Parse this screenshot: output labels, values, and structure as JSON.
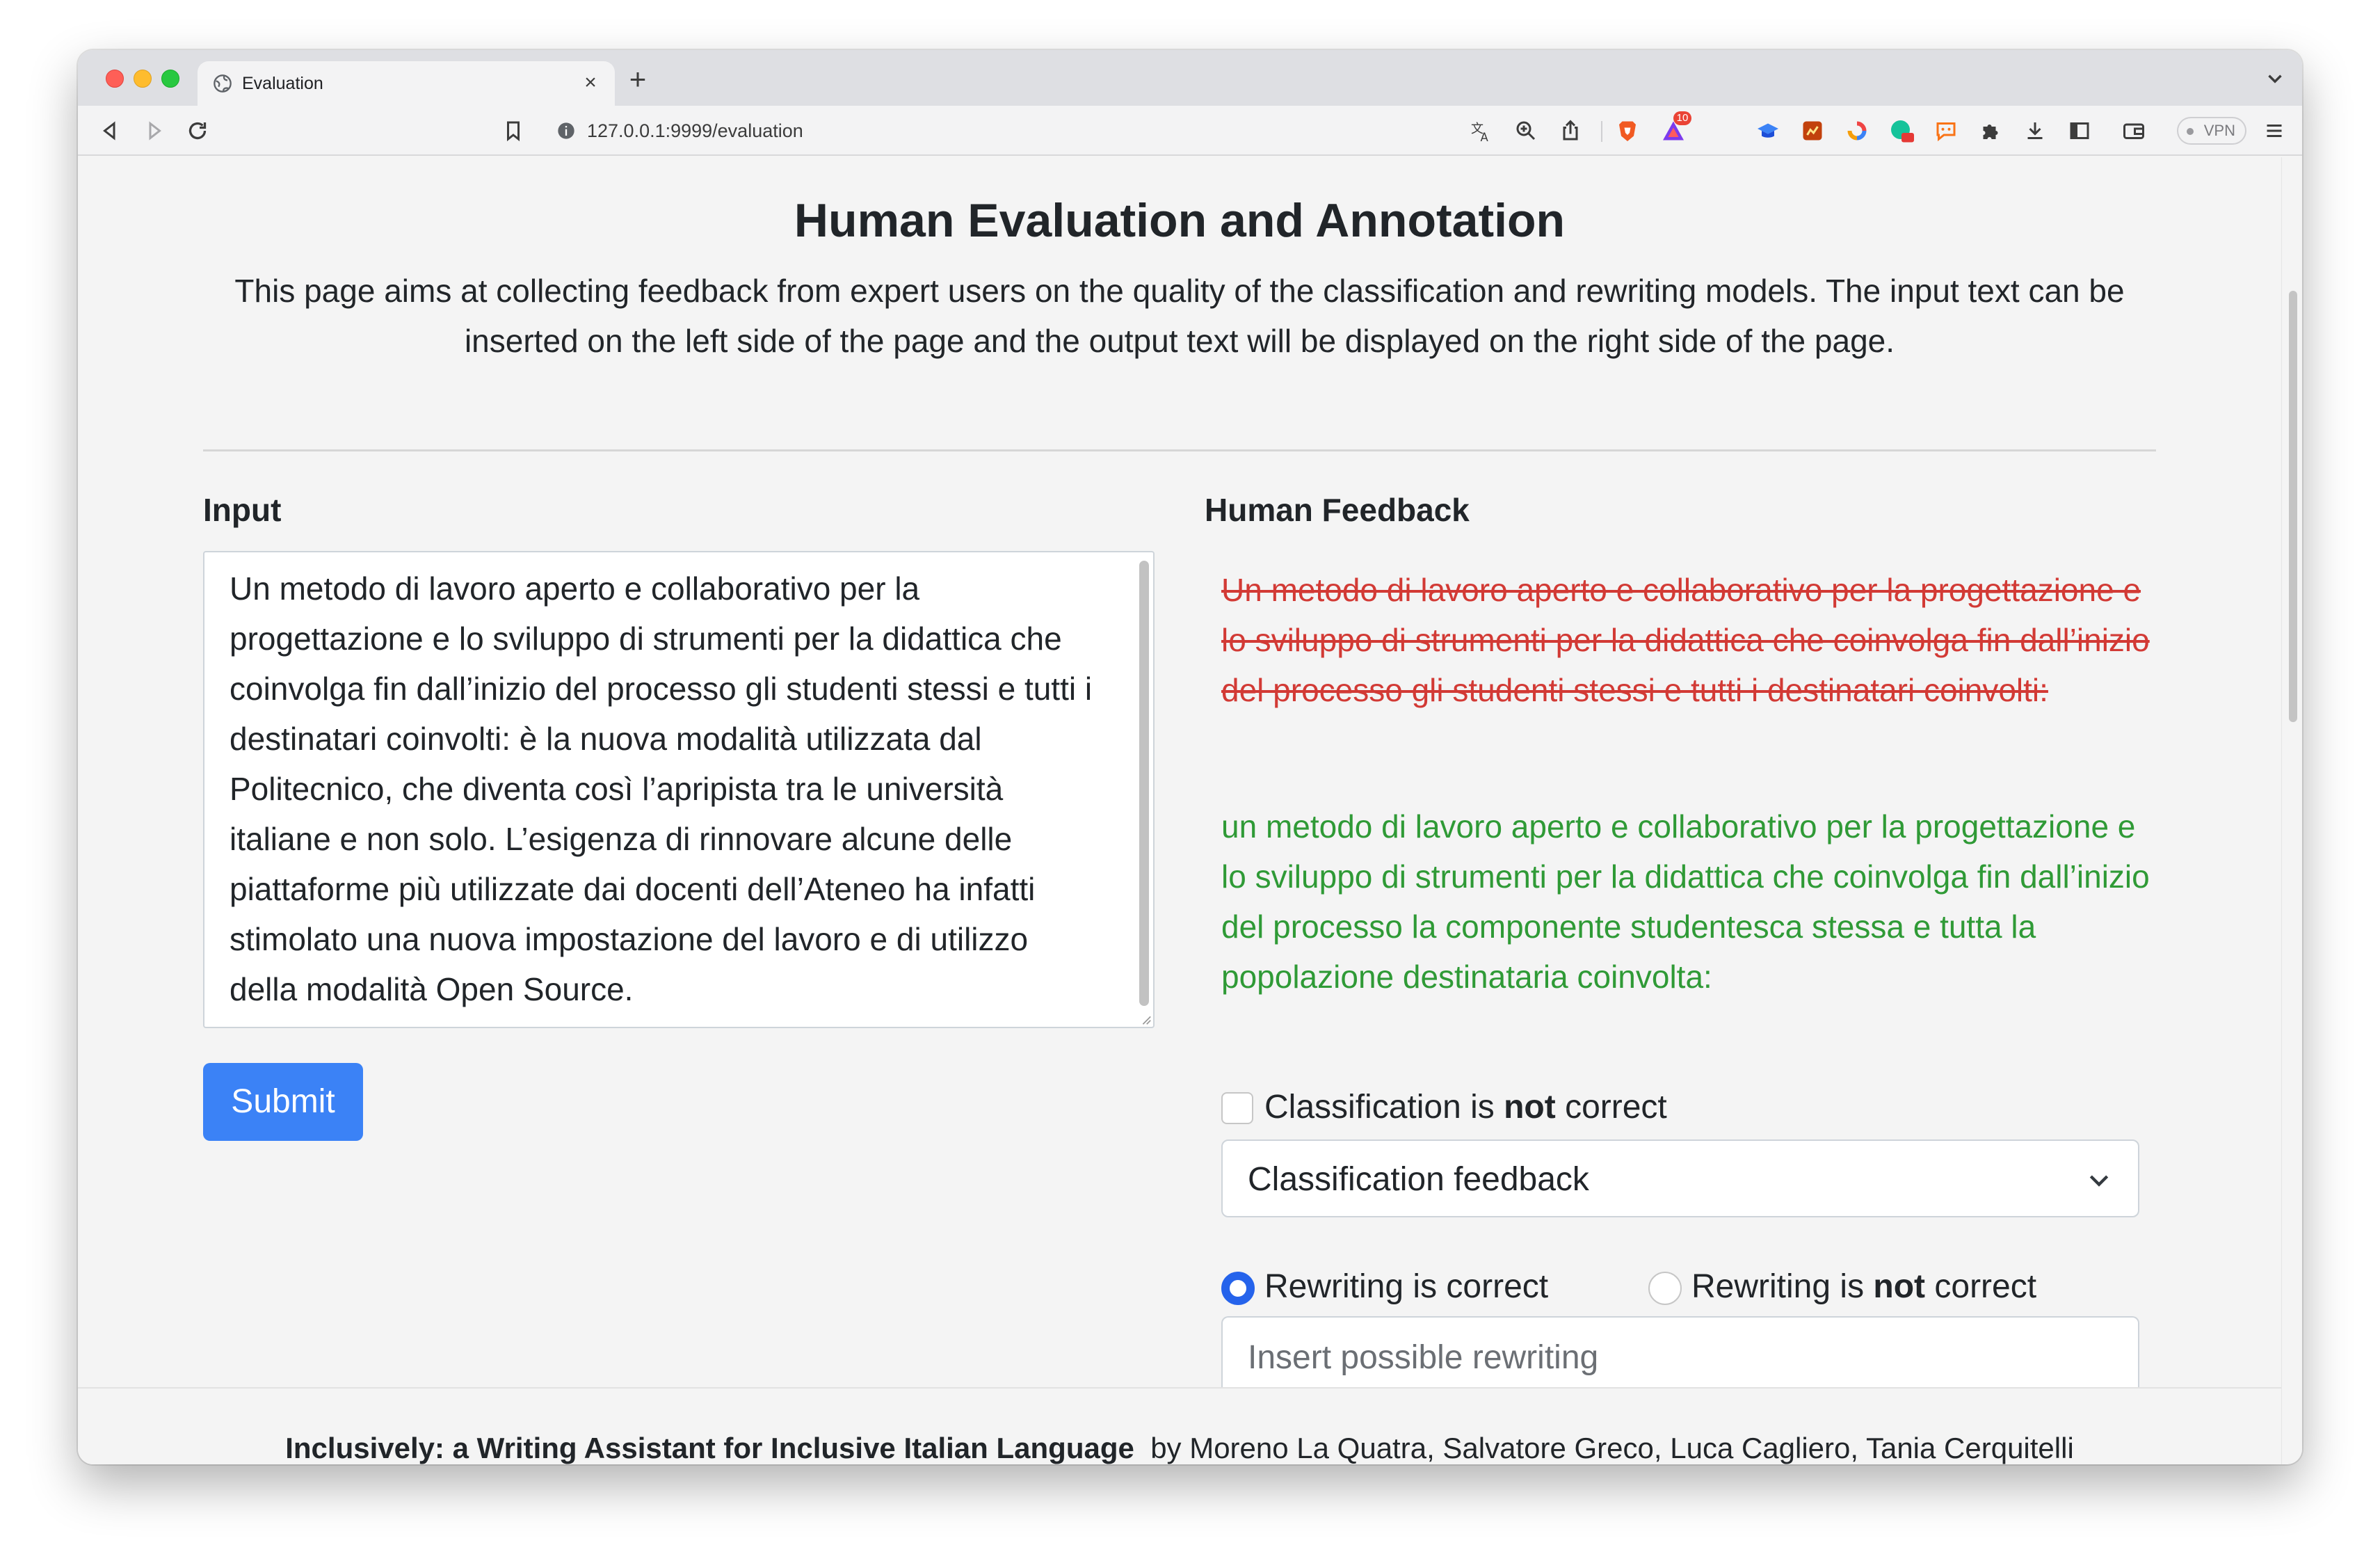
{
  "browser": {
    "tab_title": "Evaluation",
    "new_tab_label": "+",
    "url": "127.0.0.1:9999/evaluation",
    "vpn_label": "VPN",
    "extension_badge": "10"
  },
  "header": {
    "title": "Human Evaluation and Annotation",
    "description": "This page aims at collecting feedback from expert users on the quality of the classification and rewriting models. The input text can be inserted on the left side of the page and the output text will be displayed on the right side of the page."
  },
  "input_section": {
    "heading": "Input",
    "text": "Un metodo di lavoro aperto e collaborativo per la progettazione e lo sviluppo di strumenti per la didattica che coinvolga fin dall’inizio del processo gli studenti stessi e tutti i destinatari coinvolti: è la nuova modalità utilizzata dal Politecnico, che diventa così l’apripista tra le università italiane e non solo. L’esigenza di rinnovare alcune delle piattaforme più utilizzate dai docenti dell’Ateneo ha infatti stimolato una nuova impostazione del lavoro e di utilizzo della modalità Open Source.",
    "submit_label": "Submit"
  },
  "feedback_section": {
    "heading": "Human Feedback",
    "original_sentence": "Un metodo di lavoro aperto e collaborativo per la progettazione e lo sviluppo di strumenti per la didattica che coinvolga fin dall’inizio del processo gli studenti stessi e tutti i destinatari coinvolti:",
    "rewritten_sentence": "un metodo di lavoro aperto e collaborativo per la progettazione e lo sviluppo di strumenti per la didattica che coinvolga fin dall’inizio del processo la componente studentesca stessa e tutta la popolazione destinataria coinvolta:",
    "classification_checkbox": {
      "label_before": "Classification is ",
      "label_bold": "not",
      "label_after": " correct",
      "checked": false
    },
    "classification_select": {
      "selected": "Classification feedback"
    },
    "rewriting_radio_correct": {
      "label": "Rewriting is correct",
      "checked": true
    },
    "rewriting_radio_incorrect": {
      "label_before": "Rewriting is ",
      "label_bold": "not",
      "label_after": " correct",
      "checked": false
    },
    "rewrite_input": {
      "placeholder": "Insert possible rewriting",
      "value": ""
    }
  },
  "footer": {
    "title": "Inclusively: a Writing Assistant for Inclusive Italian Language",
    "authors": "by Moreno La Quatra, Salvatore Greco, Luca Cagliero, Tania Cerquitelli"
  },
  "colors": {
    "primary_button": "#3b82f6",
    "radio_selected": "#2563eb",
    "strikethrough_text": "#d23a35",
    "rewrite_text": "#2f9a36"
  }
}
